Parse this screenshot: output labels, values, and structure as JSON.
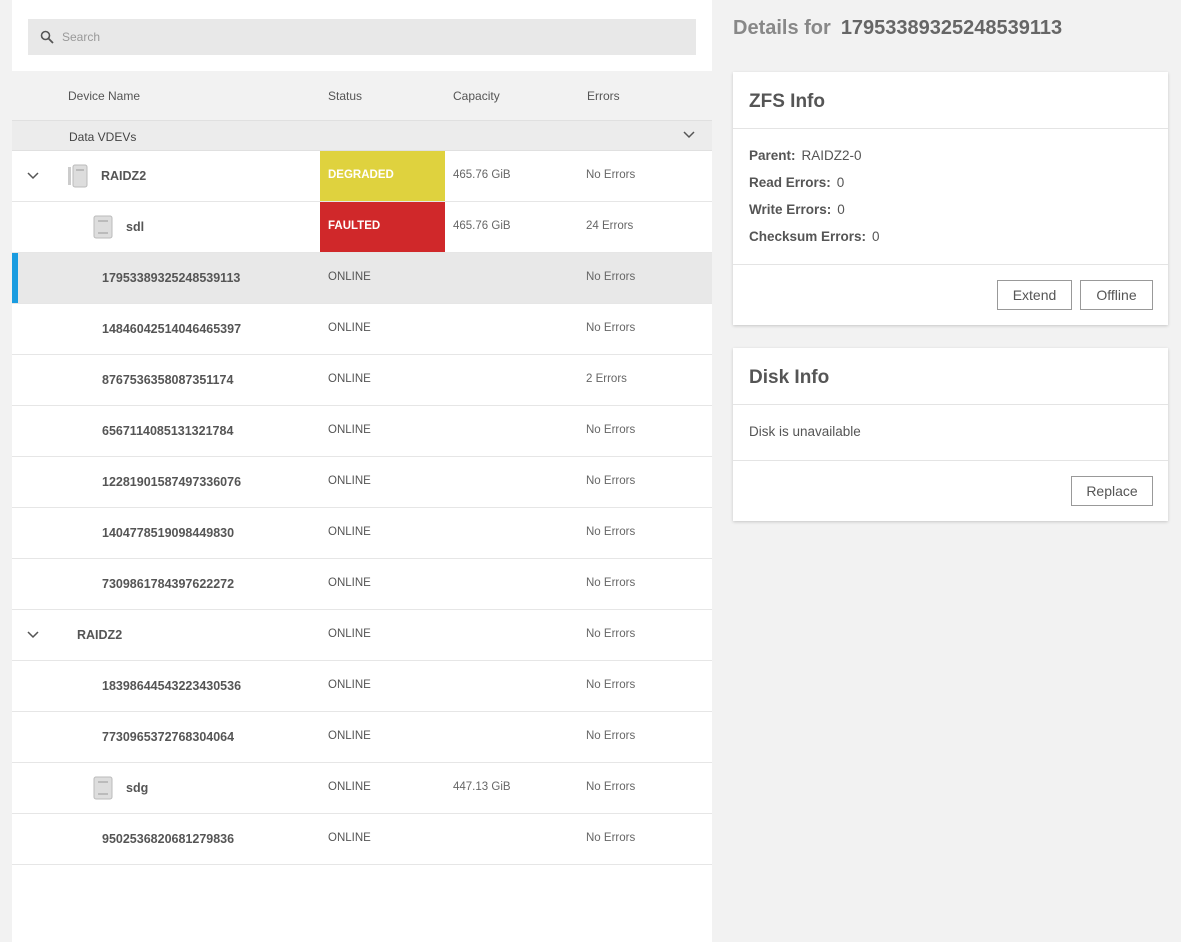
{
  "search": {
    "placeholder": "Search"
  },
  "table": {
    "headers": {
      "device_name": "Device Name",
      "status": "Status",
      "capacity": "Capacity",
      "errors": "Errors"
    },
    "group_label": "Data VDEVs",
    "rows": [
      {
        "name": "RAIDZ2",
        "status": "DEGRADED",
        "capacity": "465.76 GiB",
        "errors": "No Errors"
      },
      {
        "name": "sdl",
        "status": "FAULTED",
        "capacity": "465.76 GiB",
        "errors": "24 Errors"
      },
      {
        "name": "17953389325248539113",
        "status": "ONLINE",
        "capacity": "",
        "errors": "No Errors"
      },
      {
        "name": "14846042514046465397",
        "status": "ONLINE",
        "capacity": "",
        "errors": "No Errors"
      },
      {
        "name": "8767536358087351174",
        "status": "ONLINE",
        "capacity": "",
        "errors": "2 Errors"
      },
      {
        "name": "6567114085131321784",
        "status": "ONLINE",
        "capacity": "",
        "errors": "No Errors"
      },
      {
        "name": "12281901587497336076",
        "status": "ONLINE",
        "capacity": "",
        "errors": "No Errors"
      },
      {
        "name": "1404778519098449830",
        "status": "ONLINE",
        "capacity": "",
        "errors": "No Errors"
      },
      {
        "name": "7309861784397622272",
        "status": "ONLINE",
        "capacity": "",
        "errors": "No Errors"
      },
      {
        "name": "RAIDZ2",
        "status": "ONLINE",
        "capacity": "",
        "errors": "No Errors"
      },
      {
        "name": "18398644543223430536",
        "status": "ONLINE",
        "capacity": "",
        "errors": "No Errors"
      },
      {
        "name": "7730965372768304064",
        "status": "ONLINE",
        "capacity": "",
        "errors": "No Errors"
      },
      {
        "name": "sdg",
        "status": "ONLINE",
        "capacity": "447.13 GiB",
        "errors": "No Errors"
      },
      {
        "name": "9502536820681279836",
        "status": "ONLINE",
        "capacity": "",
        "errors": "No Errors"
      }
    ]
  },
  "details": {
    "title_prefix": "Details for",
    "title_id": "17953389325248539113",
    "zfs": {
      "title": "ZFS Info",
      "parent_label": "Parent:",
      "parent_value": "RAIDZ2-0",
      "read_label": "Read Errors:",
      "read_value": "0",
      "write_label": "Write Errors:",
      "write_value": "0",
      "checksum_label": "Checksum Errors:",
      "checksum_value": "0",
      "extend_label": "Extend",
      "offline_label": "Offline"
    },
    "disk": {
      "title": "Disk Info",
      "message": "Disk is unavailable",
      "replace_label": "Replace"
    }
  },
  "colors": {
    "degraded": "#dfd23e",
    "faulted": "#d0282a",
    "selected_accent": "#1a9ce0"
  }
}
